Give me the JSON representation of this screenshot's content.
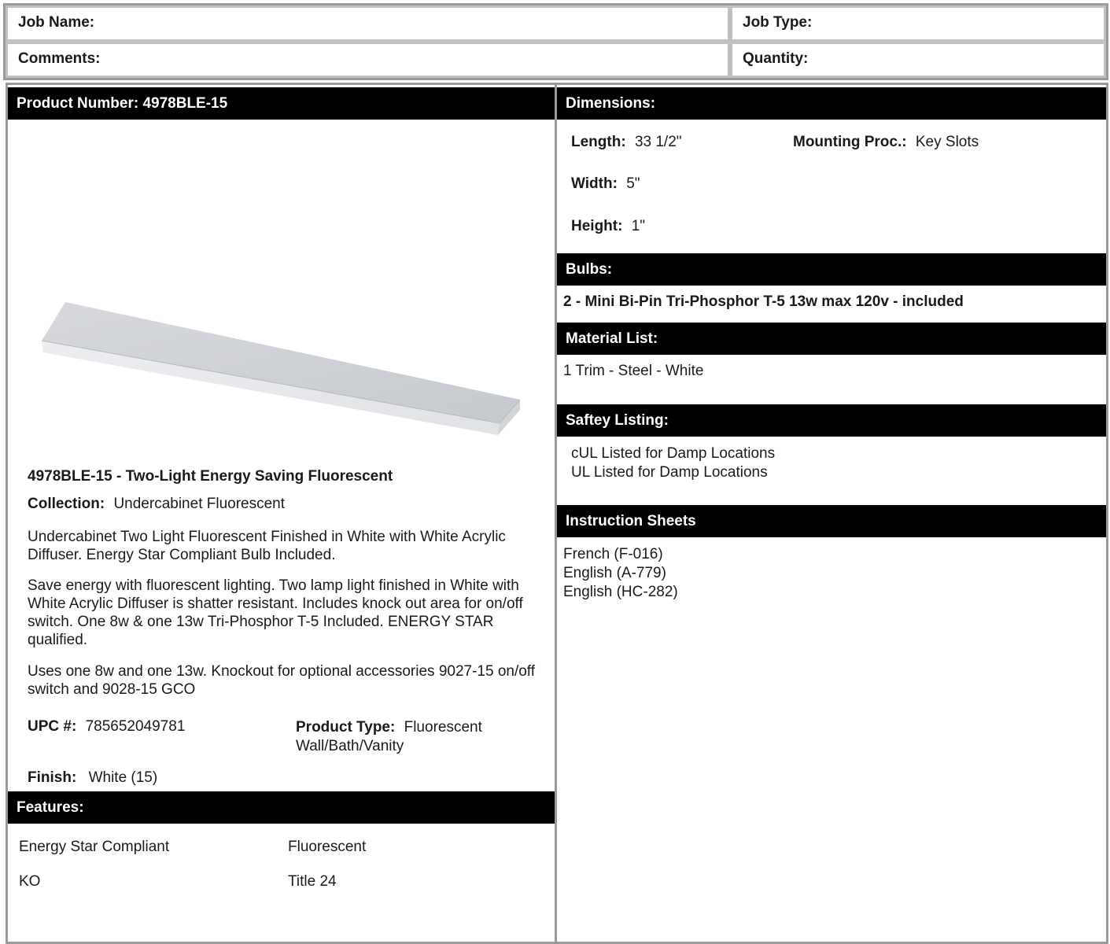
{
  "header": {
    "job_name_label": "Job Name:",
    "job_type_label": "Job Type:",
    "comments_label": "Comments:",
    "quantity_label": "Quantity:"
  },
  "product": {
    "number_heading": "Product Number: 4978BLE-15",
    "title": "4978BLE-15 - Two-Light Energy Saving Fluorescent",
    "collection_label": "Collection:",
    "collection_value": "Undercabinet Fluorescent",
    "description_1": "Undercabinet Two Light Fluorescent Finished in White with White Acrylic Diffuser. Energy Star Compliant Bulb Included.",
    "description_2": "Save energy with fluorescent lighting. Two lamp light finished in White with White Acrylic Diffuser is shatter resistant. Includes knock out area for on/off switch. One 8w & one 13w Tri-Phosphor T-5 Included. ENERGY STAR qualified.",
    "description_3": "Uses one 8w and one 13w. Knockout for optional accessories 9027-15 on/off switch and 9028-15 GCO",
    "upc_label": "UPC #:",
    "upc_value": "785652049781",
    "type_label": "Product Type:",
    "type_value": "Fluorescent Wall/Bath/Vanity",
    "finish_label": "Finish:",
    "finish_value": "White (15)",
    "image_icon": "fluorescent-fixture-image"
  },
  "features": {
    "heading": "Features:",
    "items": [
      "Energy Star Compliant",
      "Fluorescent",
      "KO",
      "Title 24"
    ]
  },
  "dimensions": {
    "heading": "Dimensions:",
    "length_label": "Length:",
    "length_value": "33 1/2\"",
    "width_label": "Width:",
    "width_value": "5\"",
    "height_label": "Height:",
    "height_value": "1\"",
    "mounting_label": "Mounting Proc.:",
    "mounting_value": "Key Slots"
  },
  "bulbs": {
    "heading": "Bulbs:",
    "value": "2 - Mini Bi-Pin Tri-Phosphor T-5 13w max 120v - included"
  },
  "material": {
    "heading": "Material List:",
    "value": "1 Trim - Steel - White"
  },
  "safety": {
    "heading": "Saftey Listing:",
    "items": [
      "cUL Listed for Damp Locations",
      "UL Listed for Damp Locations"
    ]
  },
  "instructions": {
    "heading": "Instruction Sheets",
    "items": [
      "French (F-016)",
      "English (A-779)",
      "English (HC-282)"
    ]
  },
  "colors": {
    "bar_background": "#000000",
    "bar_text": "#ffffff",
    "border": "#9a9a9a"
  }
}
